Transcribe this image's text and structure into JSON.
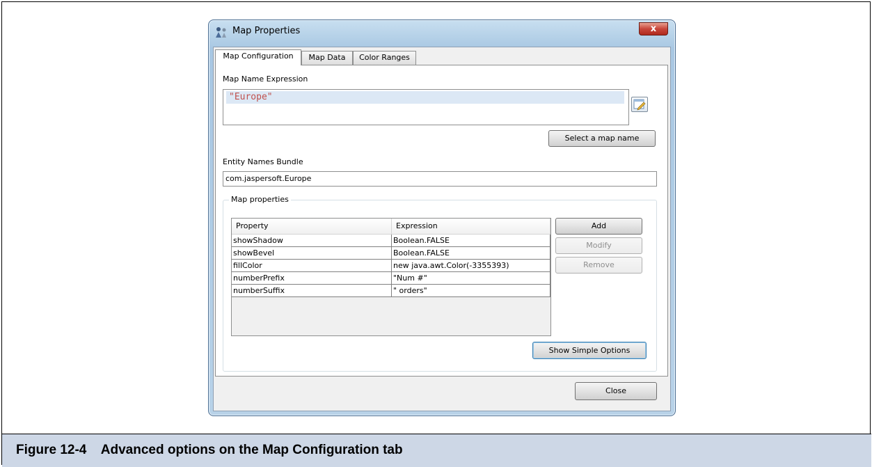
{
  "window": {
    "title": "Map Properties",
    "close_symbol": "x"
  },
  "tabs": [
    {
      "label": "Map Configuration",
      "active": true
    },
    {
      "label": "Map Data",
      "active": false
    },
    {
      "label": "Color Ranges",
      "active": false
    }
  ],
  "map_name": {
    "label": "Map Name Expression",
    "value": "\"Europe\"",
    "select_button": "Select a map name"
  },
  "entity_names": {
    "label": "Entity Names Bundle",
    "value": "com.jaspersoft.Europe"
  },
  "map_properties": {
    "group_title": "Map properties",
    "columns": [
      "Property",
      "Expression"
    ],
    "rows": [
      {
        "property": "showShadow",
        "expression": "Boolean.FALSE"
      },
      {
        "property": "showBevel",
        "expression": "Boolean.FALSE"
      },
      {
        "property": "fillColor",
        "expression": "new java.awt.Color(-3355393)"
      },
      {
        "property": "numberPrefix",
        "expression": "\"Num #\""
      },
      {
        "property": "numberSuffix",
        "expression": "\" orders\""
      }
    ],
    "buttons": {
      "add": "Add",
      "modify": "Modify",
      "remove": "Remove",
      "show_simple": "Show Simple Options"
    }
  },
  "footer": {
    "close_button": "Close"
  },
  "caption": {
    "text": "Figure 12-4    Advanced options on the Map Configuration tab"
  },
  "icons": {
    "app": "map-properties-icon",
    "edit": "edit-expression-icon"
  },
  "colors": {
    "expression_text": "#c0504d",
    "caption_background": "#cdd7e6"
  }
}
